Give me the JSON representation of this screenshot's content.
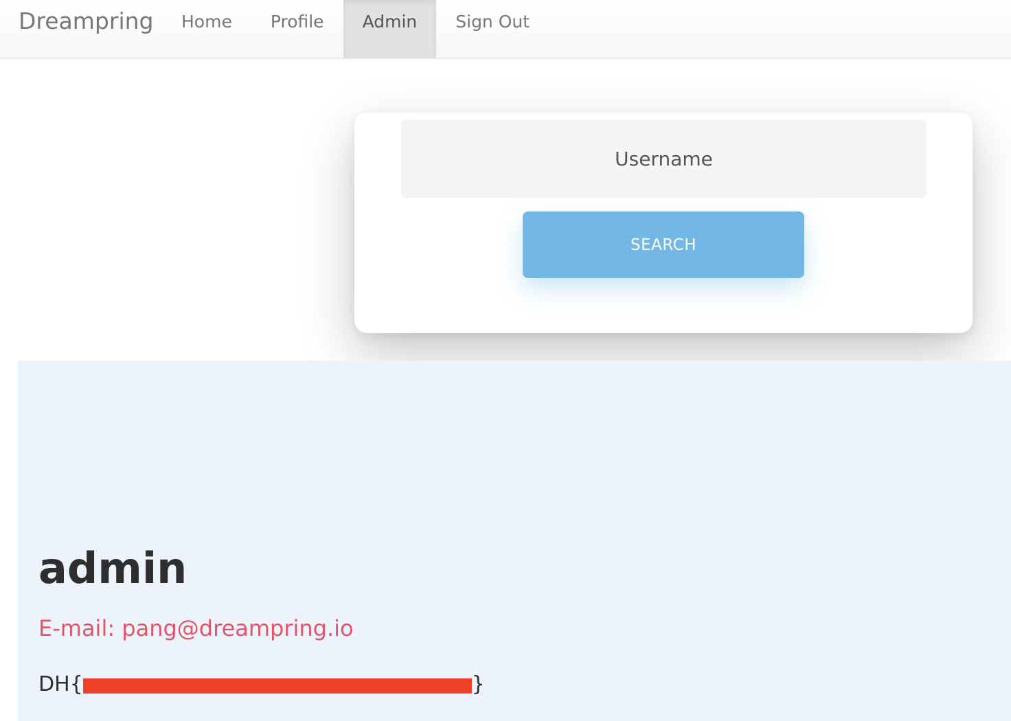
{
  "navbar": {
    "brand": "Dreampring",
    "links": [
      {
        "label": "Home",
        "active": false
      },
      {
        "label": "Profile",
        "active": false
      },
      {
        "label": "Admin",
        "active": true
      },
      {
        "label": "Sign Out",
        "active": false
      }
    ]
  },
  "search": {
    "placeholder": "Username",
    "value": "",
    "button_label": "SEARCH"
  },
  "profile": {
    "name": "admin",
    "email": "E-mail: pang@dreampring.io",
    "flag_prefix": "DH{",
    "flag_suffix": "}",
    "flag_redacted": true
  },
  "colors": {
    "accent_button": "#72b7e6",
    "email_text": "#e3546b",
    "panel_background": "#ecf3fa",
    "redaction": "#ef4129"
  }
}
